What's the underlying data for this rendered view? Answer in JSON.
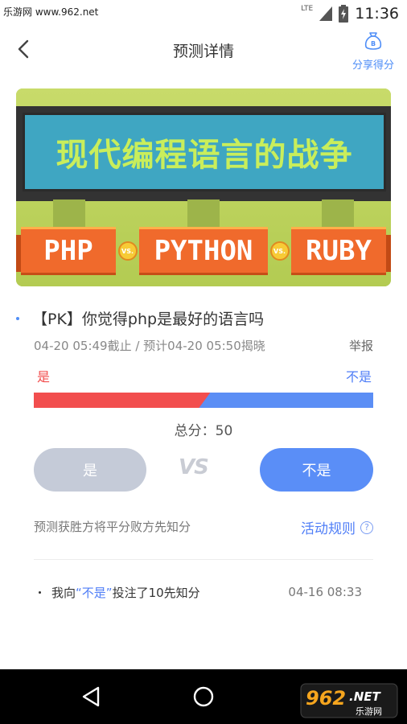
{
  "status_bar": {
    "watermark": "乐游网 www.962.net",
    "network": "LTE",
    "time": "11:36"
  },
  "header": {
    "title": "预测详情",
    "share_label": "分享得分",
    "share_icon_glyph": "B"
  },
  "banner": {
    "title": "现代编程语言的战争",
    "ribbon": [
      "PHP",
      "PYTHON",
      "RUBY"
    ],
    "vs_text": "VS."
  },
  "question": {
    "title": "【PK】你觉得php是最好的语言吗",
    "meta": "04-20 05:49截止 / 预计04-20 05:50揭晓",
    "report_label": "举报",
    "option_yes": "是",
    "option_no": "不是",
    "yes_fraction": 0.52,
    "score_label": "总分：",
    "score_value": "50"
  },
  "vote_buttons": {
    "yes": "是",
    "vs": "VS",
    "no": "不是"
  },
  "rules": {
    "note": "预测获胜方将平分败方先知分",
    "link": "活动规则",
    "help_glyph": "?"
  },
  "records": [
    {
      "prefix": "我向",
      "choice": "“不是”",
      "suffix": "投注了10先知分",
      "time": "04-16 08:33"
    }
  ],
  "watermark_logo": {
    "number": "962",
    "suffix": ".NET",
    "text": "乐游网"
  },
  "colors": {
    "accent_blue": "#5a8ef7",
    "yes_red": "#f24e4e",
    "muted_button": "#c5cbd8"
  }
}
